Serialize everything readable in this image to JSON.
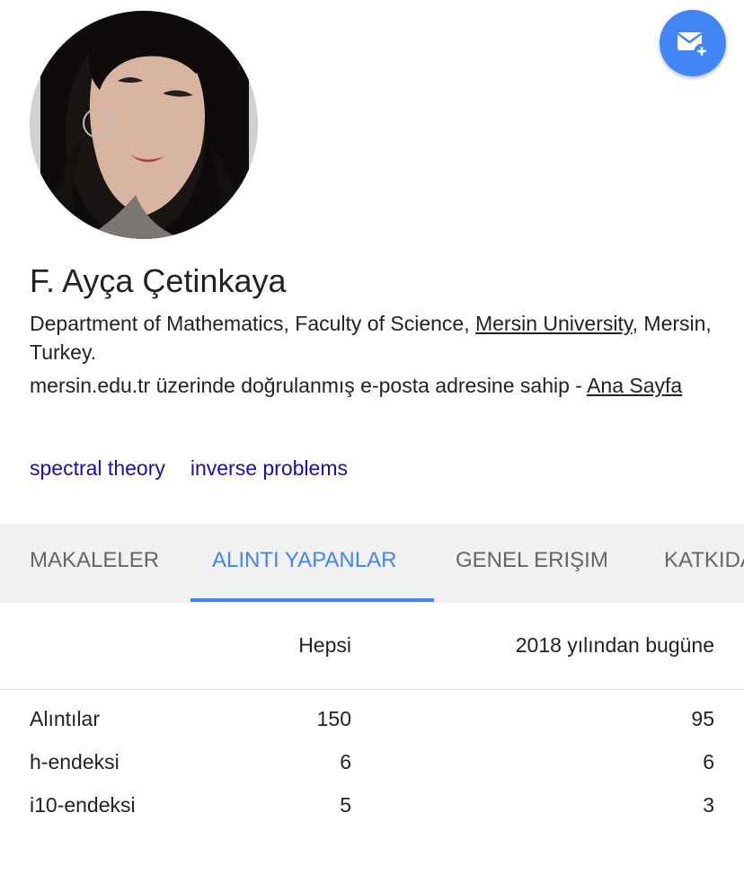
{
  "profile": {
    "name": "F. Ayça Çetinkaya",
    "affiliation_prefix": "Department of Mathematics, Faculty of Science, ",
    "affiliation_link": "Mersin University",
    "affiliation_suffix": ", Mersin, Turkey.",
    "email_text": "mersin.edu.tr üzerinde doğrulanmış e-posta adresine sahip - ",
    "homepage_link": "Ana Sayfa",
    "interests": [
      "spectral theory",
      "inverse problems"
    ]
  },
  "follow_button": {
    "icon": "mail-plus-icon",
    "color": "#4285f4"
  },
  "tabs": [
    {
      "label": "MAKALELER",
      "active": false
    },
    {
      "label": "ALINTI YAPANLAR",
      "active": true
    },
    {
      "label": "GENEL ERIŞIM",
      "active": false
    },
    {
      "label": "KATKIDA",
      "active": false
    }
  ],
  "metrics": {
    "headers": {
      "all": "Hepsi",
      "since": "2018 yılından bugüne"
    },
    "rows": [
      {
        "label": "Alıntılar",
        "all": "150",
        "since": "95"
      },
      {
        "label": "h-endeksi",
        "all": "6",
        "since": "6"
      },
      {
        "label": "i10-endeksi",
        "all": "5",
        "since": "3"
      }
    ]
  },
  "colors": {
    "accent": "#4285f4",
    "link": "#1a0dab",
    "tab_bg": "#f1f1f1",
    "muted": "#666666"
  }
}
